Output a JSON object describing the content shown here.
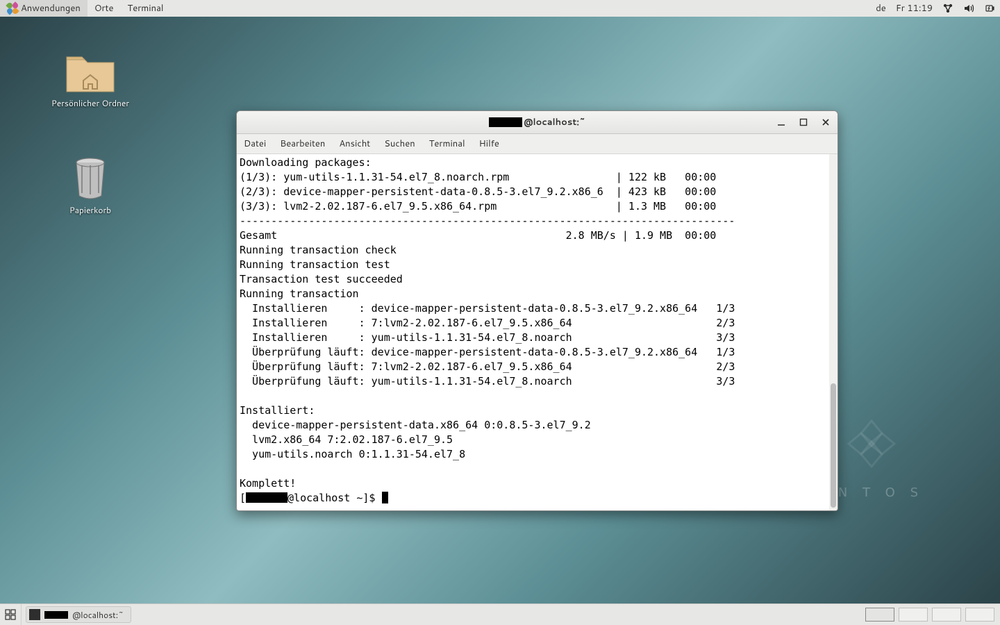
{
  "top_panel": {
    "menus": [
      "Anwendungen",
      "Orte",
      "Terminal"
    ],
    "kb_layout": "de",
    "clock": "Fr 11:19"
  },
  "desktop_icons": {
    "home": "Persönlicher Ordner",
    "trash": "Papierkorb"
  },
  "centos_mark": "C E N T O S",
  "terminal": {
    "title_suffix": "@localhost:~",
    "menus": [
      "Datei",
      "Bearbeiten",
      "Ansicht",
      "Suchen",
      "Terminal",
      "Hilfe"
    ],
    "lines": {
      "l0": "Downloading packages:",
      "l1": "(1/3): yum-utils-1.1.31-54.el7_8.noarch.rpm                 | 122 kB   00:00",
      "l2": "(2/3): device-mapper-persistent-data-0.8.5-3.el7_9.2.x86_6  | 423 kB   00:00",
      "l3": "(3/3): lvm2-2.02.187-6.el7_9.5.x86_64.rpm                   | 1.3 MB   00:00",
      "l4": "-------------------------------------------------------------------------------",
      "l5": "Gesamt                                              2.8 MB/s | 1.9 MB  00:00",
      "l6": "Running transaction check",
      "l7": "Running transaction test",
      "l8": "Transaction test succeeded",
      "l9": "Running transaction",
      "l10": "  Installieren     : device-mapper-persistent-data-0.8.5-3.el7_9.2.x86_64   1/3",
      "l11": "  Installieren     : 7:lvm2-2.02.187-6.el7_9.5.x86_64                       2/3",
      "l12": "  Installieren     : yum-utils-1.1.31-54.el7_8.noarch                       3/3",
      "l13": "  Überprüfung läuft: device-mapper-persistent-data-0.8.5-3.el7_9.2.x86_64   1/3",
      "l14": "  Überprüfung läuft: 7:lvm2-2.02.187-6.el7_9.5.x86_64                       2/3",
      "l15": "  Überprüfung läuft: yum-utils-1.1.31-54.el7_8.noarch                       3/3",
      "l16": "",
      "l17": "Installiert:",
      "l18": "  device-mapper-persistent-data.x86_64 0:0.8.5-3.el7_9.2",
      "l19": "  lvm2.x86_64 7:2.02.187-6.el7_9.5",
      "l20": "  yum-utils.noarch 0:1.1.31-54.el7_8",
      "l21": "",
      "l22": "Komplett!"
    },
    "prompt_prefix": "[",
    "prompt_suffix": "@localhost ~]$ "
  },
  "taskbar": {
    "entry_suffix": "@localhost:~"
  }
}
